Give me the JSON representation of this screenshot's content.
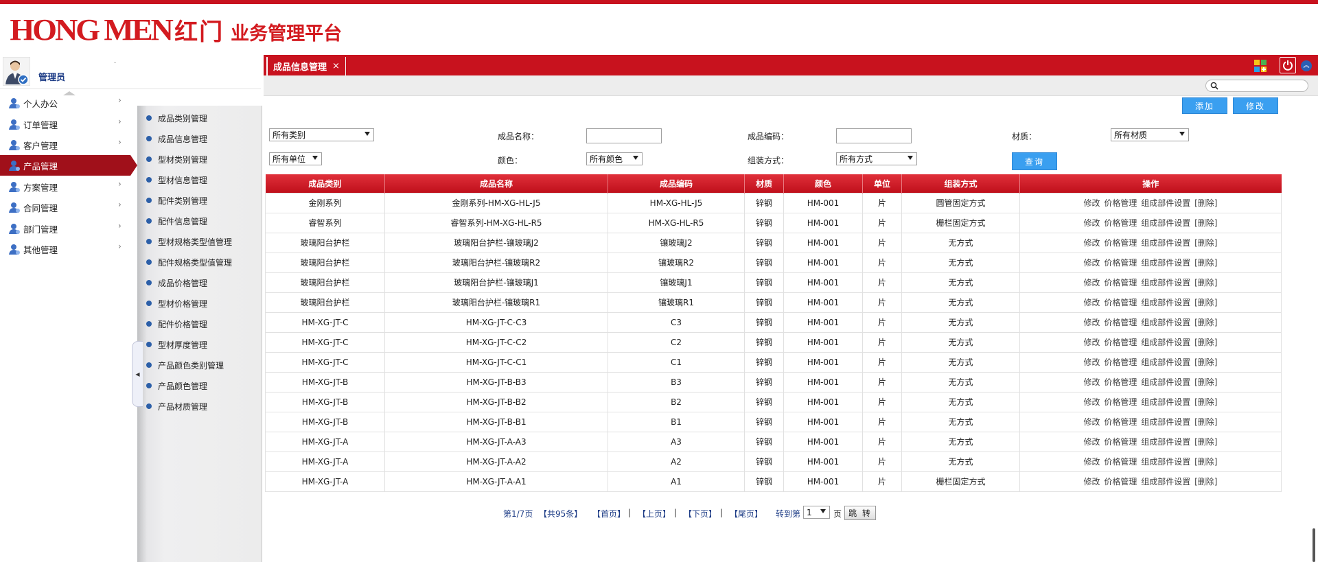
{
  "brand": {
    "logo_en": "HONG MEN",
    "logo_cn": "红门",
    "platform": "业务管理平台",
    "accent": "#c8121e"
  },
  "user": {
    "name": "管理员",
    "mark": "."
  },
  "nav": {
    "items": [
      {
        "label": "个人办公"
      },
      {
        "label": "订单管理"
      },
      {
        "label": "客户管理"
      },
      {
        "label": "产品管理"
      },
      {
        "label": "方案管理"
      },
      {
        "label": "合同管理"
      },
      {
        "label": "部门管理"
      },
      {
        "label": "其他管理"
      }
    ],
    "active": "产品管理"
  },
  "subnav": {
    "items": [
      {
        "label": "成品类别管理"
      },
      {
        "label": "成品信息管理"
      },
      {
        "label": "型材类别管理"
      },
      {
        "label": "型材信息管理"
      },
      {
        "label": "配件类别管理"
      },
      {
        "label": "配件信息管理"
      },
      {
        "label": "型材规格类型值管理"
      },
      {
        "label": "配件规格类型值管理"
      },
      {
        "label": "成品价格管理"
      },
      {
        "label": "型材价格管理"
      },
      {
        "label": "配件价格管理"
      },
      {
        "label": "型材厚度管理"
      },
      {
        "label": "产品颜色类别管理"
      },
      {
        "label": "产品颜色管理"
      },
      {
        "label": "产品材质管理"
      }
    ]
  },
  "tab": {
    "label": "成品信息管理",
    "close": "×"
  },
  "search": {
    "placeholder": ""
  },
  "buttons": {
    "add": "添加",
    "edit": "修改",
    "query": "查询"
  },
  "filters": {
    "category": "所有类别",
    "name_label": "成品名称：",
    "name_value": "",
    "code_label": "成品编码：",
    "code_value": "",
    "material_label": "材质：",
    "material": "所有材质",
    "unit": "所有单位",
    "color_label": "颜色：",
    "color": "所有颜色",
    "assembly_label": "组装方式：",
    "assembly": "所有方式"
  },
  "table": {
    "headers": [
      "成品类别",
      "成品名称",
      "成品编码",
      "材质",
      "颜色",
      "单位",
      "组装方式",
      "操作"
    ],
    "ops": {
      "edit": "修改",
      "price": "价格管理",
      "parts": "组成部件设置",
      "delete": "[删除]"
    },
    "rows": [
      [
        "金刚系列",
        "金刚系列-HM-XG-HL-J5",
        "HM-XG-HL-J5",
        "锌钢",
        "HM-001",
        "片",
        "圆管固定方式"
      ],
      [
        "睿智系列",
        "睿智系列-HM-XG-HL-R5",
        "HM-XG-HL-R5",
        "锌钢",
        "HM-001",
        "片",
        "栅栏固定方式"
      ],
      [
        "玻璃阳台护栏",
        "玻璃阳台护栏-镶玻璃J2",
        "镶玻璃J2",
        "锌钢",
        "HM-001",
        "片",
        "无方式"
      ],
      [
        "玻璃阳台护栏",
        "玻璃阳台护栏-镶玻璃R2",
        "镶玻璃R2",
        "锌钢",
        "HM-001",
        "片",
        "无方式"
      ],
      [
        "玻璃阳台护栏",
        "玻璃阳台护栏-镶玻璃J1",
        "镶玻璃J1",
        "锌钢",
        "HM-001",
        "片",
        "无方式"
      ],
      [
        "玻璃阳台护栏",
        "玻璃阳台护栏-镶玻璃R1",
        "镶玻璃R1",
        "锌钢",
        "HM-001",
        "片",
        "无方式"
      ],
      [
        "HM-XG-JT-C",
        "HM-XG-JT-C-C3",
        "C3",
        "锌钢",
        "HM-001",
        "片",
        "无方式"
      ],
      [
        "HM-XG-JT-C",
        "HM-XG-JT-C-C2",
        "C2",
        "锌钢",
        "HM-001",
        "片",
        "无方式"
      ],
      [
        "HM-XG-JT-C",
        "HM-XG-JT-C-C1",
        "C1",
        "锌钢",
        "HM-001",
        "片",
        "无方式"
      ],
      [
        "HM-XG-JT-B",
        "HM-XG-JT-B-B3",
        "B3",
        "锌钢",
        "HM-001",
        "片",
        "无方式"
      ],
      [
        "HM-XG-JT-B",
        "HM-XG-JT-B-B2",
        "B2",
        "锌钢",
        "HM-001",
        "片",
        "无方式"
      ],
      [
        "HM-XG-JT-B",
        "HM-XG-JT-B-B1",
        "B1",
        "锌钢",
        "HM-001",
        "片",
        "无方式"
      ],
      [
        "HM-XG-JT-A",
        "HM-XG-JT-A-A3",
        "A3",
        "锌钢",
        "HM-001",
        "片",
        "无方式"
      ],
      [
        "HM-XG-JT-A",
        "HM-XG-JT-A-A2",
        "A2",
        "锌钢",
        "HM-001",
        "片",
        "无方式"
      ],
      [
        "HM-XG-JT-A",
        "HM-XG-JT-A-A1",
        "A1",
        "锌钢",
        "HM-001",
        "片",
        "栅栏固定方式"
      ]
    ]
  },
  "pager": {
    "info": "第1/7页",
    "total": "【共95条】",
    "first": "【首页】",
    "prev": "【上页】",
    "next": "【下页】",
    "last": "【尾页】",
    "sep": "|",
    "goto_label": "转到第",
    "page_value": "1",
    "page_unit": "页",
    "jump": "跳 转"
  }
}
